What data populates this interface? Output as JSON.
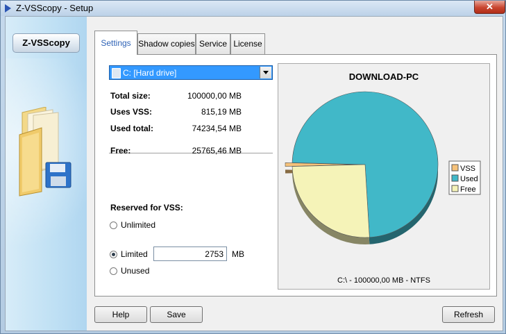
{
  "window": {
    "title": "Z-VSScopy - Setup",
    "close_label": "✕"
  },
  "sidebar": {
    "logo_label": "Z-VSScopy"
  },
  "tabs": [
    {
      "label": "Settings",
      "active": true
    },
    {
      "label": "Shadow copies",
      "active": false
    },
    {
      "label": "Service",
      "active": false
    },
    {
      "label": "License",
      "active": false
    }
  ],
  "drive": {
    "selected": "C:  [Hard drive]"
  },
  "stats": {
    "total_size_label": "Total size:",
    "total_size_value": "100000,00 MB",
    "uses_vss_label": "Uses VSS:",
    "uses_vss_value": "815,19 MB",
    "used_total_label": "Used total:",
    "used_total_value": "74234,54 MB",
    "free_label": "Free:",
    "free_value": "25765,46 MB"
  },
  "reserved": {
    "heading": "Reserved for VSS:",
    "options": [
      {
        "label": "Unlimited",
        "checked": false
      },
      {
        "label": "Limited",
        "checked": true
      },
      {
        "label": "Unused",
        "checked": false
      }
    ],
    "value": "2753",
    "unit": "MB"
  },
  "chart_data": {
    "type": "pie",
    "title": "DOWNLOAD-PC",
    "footer": "C:\\ - 100000,00 MB - NTFS",
    "slices": [
      {
        "name": "VSS",
        "value": 815.19,
        "color": "#f6c27a"
      },
      {
        "name": "Used",
        "value": 74234.54,
        "color": "#41b8c8"
      },
      {
        "name": "Free",
        "value": 25765.46,
        "color": "#f5f3b8"
      }
    ],
    "legend_position": "right"
  },
  "buttons": {
    "help": "Help",
    "save": "Save",
    "refresh": "Refresh"
  }
}
